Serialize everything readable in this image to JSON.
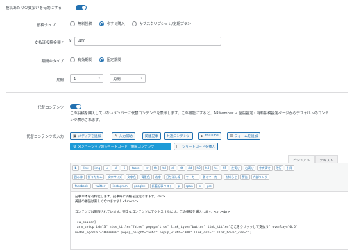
{
  "pay_per_post": {
    "label": "投稿あたりの支払いを有効にする",
    "enabled": true
  },
  "post_type": {
    "label": "投稿タイプ",
    "options": [
      "無料投稿",
      "今すぐ購入",
      "サブスクリプション/定期プラン"
    ],
    "selected_index": 1
  },
  "payment_amount": {
    "label": "支払済投稿金額 *",
    "currency": "¥",
    "value": "400"
  },
  "duration_type": {
    "label": "期間のタイプ",
    "options": [
      "有効期間",
      "固定期間"
    ],
    "selected_index": 1
  },
  "duration": {
    "label": "期間",
    "number": "1",
    "unit": "月間"
  },
  "alt_content": {
    "label": "代替コンテンツ",
    "enabled": true,
    "description_line1": "この投稿を購入していないメンバーに代替コンテンツを表示します。この機能にすると、ARMember → 全般設定・有料投稿設定ページからデフォルトのコンテ",
    "description_line2": "ンツ表示されます。"
  },
  "alt_content_input": {
    "label": "代替コンテンツの入力",
    "buttons_row1": [
      {
        "label": "メディアを追加",
        "icon": "media-icon"
      },
      {
        "label": "入力補助",
        "icon": "pencil-icon"
      },
      {
        "label": "関連記事",
        "icon": ""
      },
      {
        "label": "共通コンテンツ",
        "icon": ""
      },
      {
        "label": "YouTube",
        "icon": "youtube-icon"
      },
      {
        "label": "フォームを追加",
        "icon": "form-icon"
      }
    ],
    "buttons_row2": [
      {
        "label": "メンバーシップのショートコード　制限コンテンツ",
        "icon": "membership-icon"
      },
      {
        "label": "ショートコードを挿入",
        "icon": "shortcode-icon"
      }
    ]
  },
  "editor": {
    "tabs": [
      "ビジュアル",
      "テキスト"
    ],
    "active_tab": 1,
    "quicktags_row1": [
      "b",
      "link",
      "img",
      "ul",
      "ol",
      "li",
      "table",
      "tr",
      "th",
      "td",
      "dl",
      "dt",
      "dd",
      "h2",
      "h3",
      "h4",
      "h5",
      "左寄せ",
      "右寄せ",
      "中央寄せ",
      "改行",
      "引用"
    ],
    "quicktags_row2": [
      "囲み枠",
      "折りたたみ",
      "文字サイズ",
      "文字色",
      "背景色",
      "太字",
      "打ち消し線",
      "マーカー",
      "動くマーカー",
      "お知らせ",
      "警告",
      "内部リンク"
    ],
    "quicktags_row3": [
      "facebook",
      "twitter",
      "instagram",
      "google+",
      "新着記事リスト",
      "p",
      "span",
      "hr",
      "pre"
    ],
    "content_lines": [
      "記事単体を有料化します。記事毎に価格を設定できます。<br>",
      "英語の勉強は楽しくなれますよ！<br><br>",
      "",
      "コンテンツは制限されています。完全なコンテンツにアクセスするには、この投稿を購入します。<br><br>",
      "",
      "[su_spacer]",
      "[arm_setup id=\"3\" hide_title=\"false\" popup=\"true\" link_type=\"button\" link_title=\"ここをクリックして支払う\" overlay=\"0.6\"",
      "modal_bgcolor=\"#000000\" popup_height=\"auto\" popup_width=\"800\" link_css=\"\" link_hover_css=\"\"]"
    ]
  },
  "colors": {
    "accent": "#2271b1",
    "dark_button": "#1e9bd7",
    "toggle": "#2271b1"
  }
}
